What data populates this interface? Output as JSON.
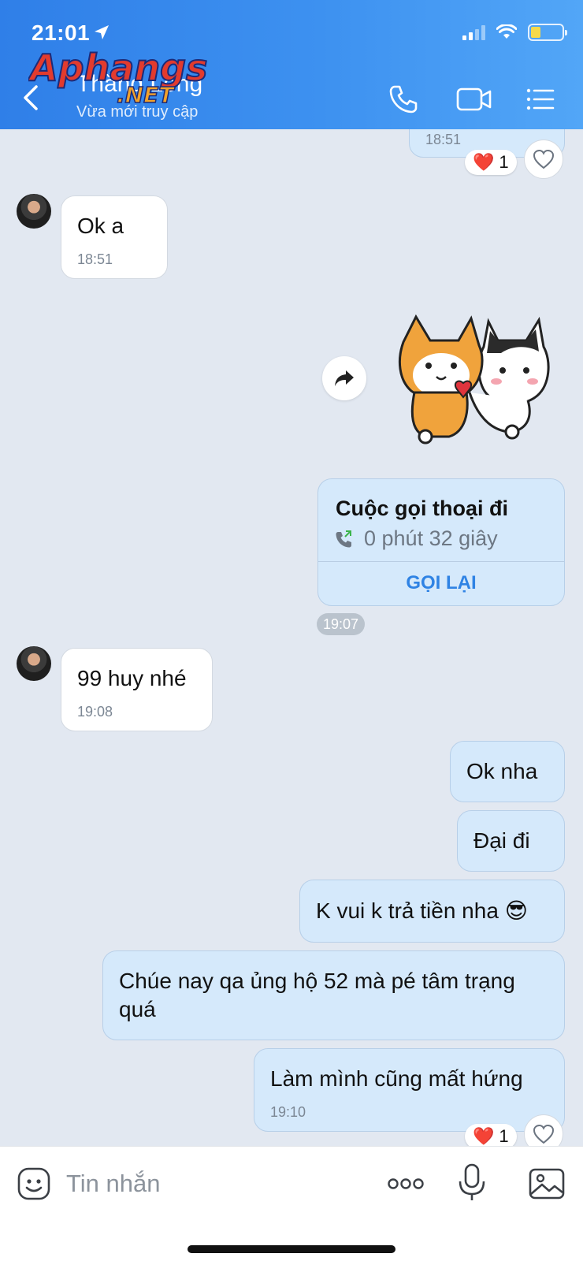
{
  "status_bar": {
    "time": "21:01"
  },
  "header": {
    "contact_name": "Thắng Long",
    "presence": "Vừa mới truy cập",
    "watermark": "Aphangs.NET"
  },
  "messages": {
    "top_partial": {
      "time": "18:51",
      "reaction": {
        "emoji": "❤️",
        "count": "1"
      }
    },
    "m1": {
      "text": "Ok a",
      "time": "18:51"
    },
    "call": {
      "title": "Cuộc gọi thoại đi",
      "duration": "0 phút 32 giây",
      "action": "GỌI LẠI",
      "time": "19:07"
    },
    "m2": {
      "text": "99 huy nhé",
      "time": "19:08"
    },
    "m3": {
      "text": "Ok nha"
    },
    "m4": {
      "text": "Đại đi"
    },
    "m5": {
      "text": "K vui k trả tiền nha",
      "emoji": "😎"
    },
    "m6": {
      "text": "Chúe nay qa ủng hộ 52 mà pé tâm trạng quá"
    },
    "m7": {
      "text": "Làm mình cũng mất hứng",
      "time": "19:10",
      "reaction": {
        "emoji": "❤️",
        "count": "1"
      }
    }
  },
  "composer": {
    "placeholder": "Tin nhắn"
  },
  "icons": {
    "back": "chevron-left-icon",
    "phone": "phone-icon",
    "video": "video-camera-icon",
    "menu": "list-menu-icon",
    "emoji": "sticker-icon",
    "more": "more-dots-icon",
    "mic": "microphone-icon",
    "gallery": "image-icon",
    "forward": "forward-arrow-icon",
    "like": "heart-outline-icon"
  },
  "colors": {
    "header_start": "#2f7fe8",
    "header_end": "#52a6f7",
    "my_bubble": "#d5e9fb",
    "link_blue": "#2f83e4",
    "background": "#e2e8f1"
  }
}
